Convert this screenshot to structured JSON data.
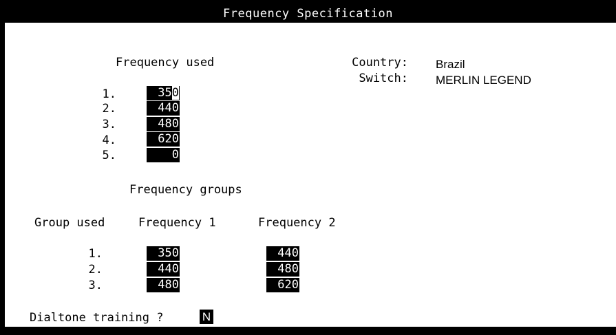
{
  "title": "Frequency Specification",
  "frequencies": {
    "heading": "Frequency used",
    "rows": [
      {
        "index": "1.",
        "value": "350"
      },
      {
        "index": "2.",
        "value": "440"
      },
      {
        "index": "3.",
        "value": "480"
      },
      {
        "index": "4.",
        "value": "620"
      },
      {
        "index": "5.",
        "value": "0"
      }
    ]
  },
  "info": {
    "country_label": "Country:",
    "country_value": "Brazil",
    "switch_label": "Switch:",
    "switch_value": "MERLIN LEGEND"
  },
  "groups": {
    "heading": "Frequency groups",
    "col_group": "Group used",
    "col_freq1": "Frequency 1",
    "col_freq2": "Frequency 2",
    "rows": [
      {
        "index": "1.",
        "freq1": "350",
        "freq2": "440"
      },
      {
        "index": "2.",
        "freq1": "440",
        "freq2": "480"
      },
      {
        "index": "3.",
        "freq1": "480",
        "freq2": "620"
      }
    ]
  },
  "dialtone": {
    "label": "Dialtone training ?",
    "value": "N"
  }
}
